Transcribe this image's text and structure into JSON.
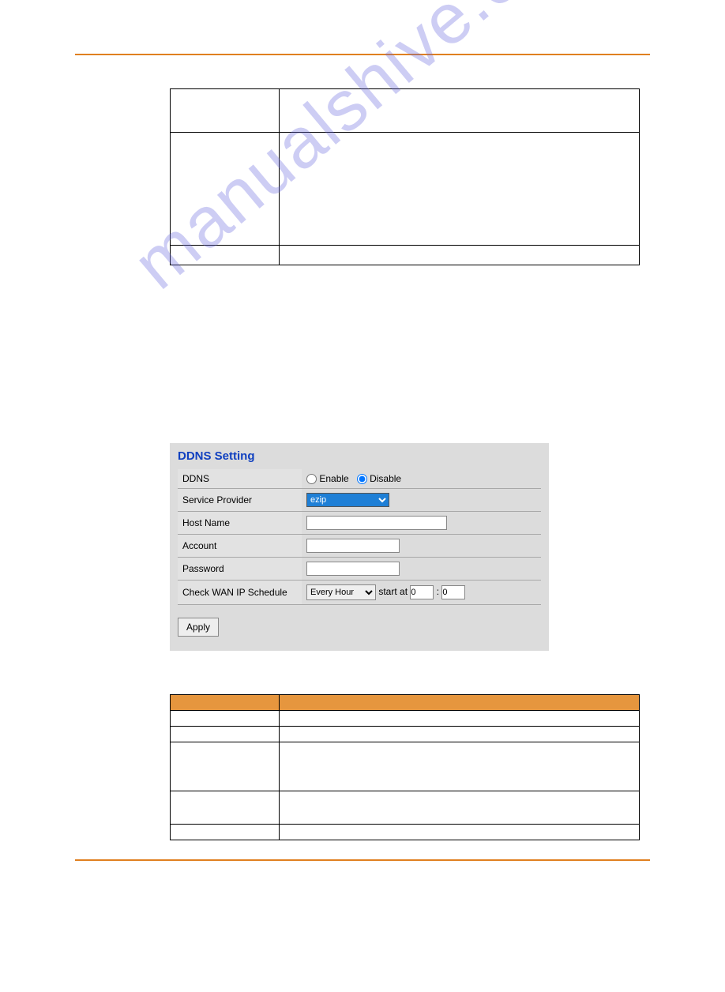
{
  "watermark": "manualshive.com",
  "ddns_panel": {
    "title": "DDNS Setting",
    "rows": {
      "ddns_label": "DDNS",
      "enable": "Enable",
      "disable": "Disable",
      "service_provider_label": "Service Provider",
      "service_provider_value": "ezip",
      "host_name_label": "Host Name",
      "host_name_value": "",
      "account_label": "Account",
      "account_value": "",
      "password_label": "Password",
      "password_value": "",
      "check_wan_label": "Check WAN IP Schedule",
      "check_wan_select": "Every Hour",
      "start_at": "start at",
      "hour_value": "0",
      "colon": ":",
      "minute_value": "0"
    },
    "apply": "Apply"
  }
}
